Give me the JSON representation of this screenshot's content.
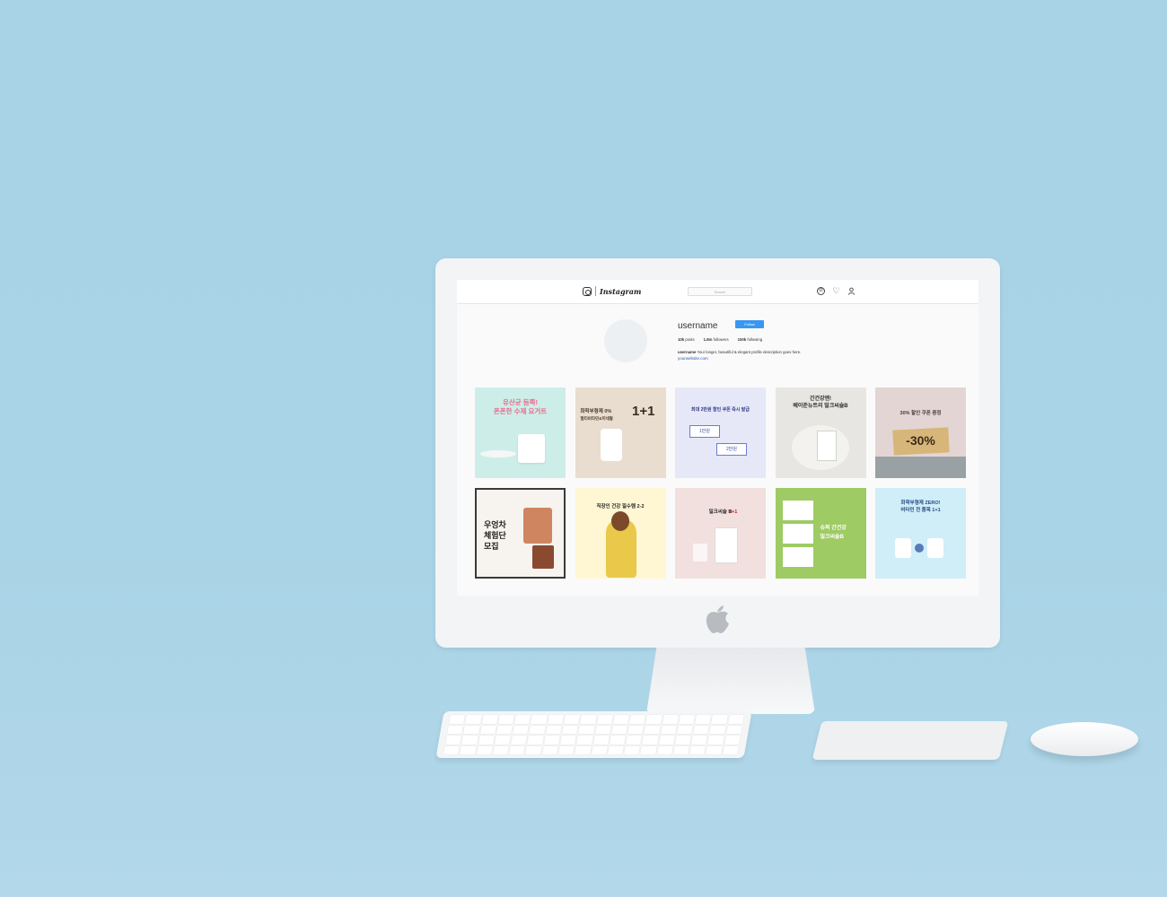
{
  "ig": {
    "brand": "Instagram",
    "search_placeholder": "Search",
    "username": "username",
    "follow_label": "Follow",
    "posts": "10k",
    "posts_label": "posts",
    "followers": "1.8m",
    "followers_label": "followers",
    "following": "100k",
    "following_label": "following",
    "bio_name": "username",
    "bio_text": "Your longer, beautiful & elegant profile description goes here.",
    "website": "yourwebsite.com"
  },
  "posts": [
    {
      "l1": "유산균 듬뿍!",
      "l2": "폰폰한 수제 요거트"
    },
    {
      "l1": "화학부형제 0%",
      "l2": "멀티비타민&미네랄",
      "big": "1+1"
    },
    {
      "l1": "최대 2만원 할인 쿠폰 즉시 발급",
      "a": "1만원",
      "b": "2만원"
    },
    {
      "l1": "간건강엔!",
      "l2": "베이준뉴트리 밀크씨슬B"
    },
    {
      "l1": "30% 할인 쿠폰 증정",
      "big": "-30%"
    },
    {
      "l1": "우엉차",
      "l2": "체험단",
      "l3": "모집"
    },
    {
      "l1": "직장인 건강 필수템 2-2"
    },
    {
      "l1": "밀크씨슬 B",
      "big": "1+1"
    },
    {
      "l1": "슈퍼 간건강",
      "l2": "밀크씨슬B"
    },
    {
      "l1": "화학부형제 ZERO!",
      "l2": "비타민 전 품목 1+1"
    }
  ]
}
